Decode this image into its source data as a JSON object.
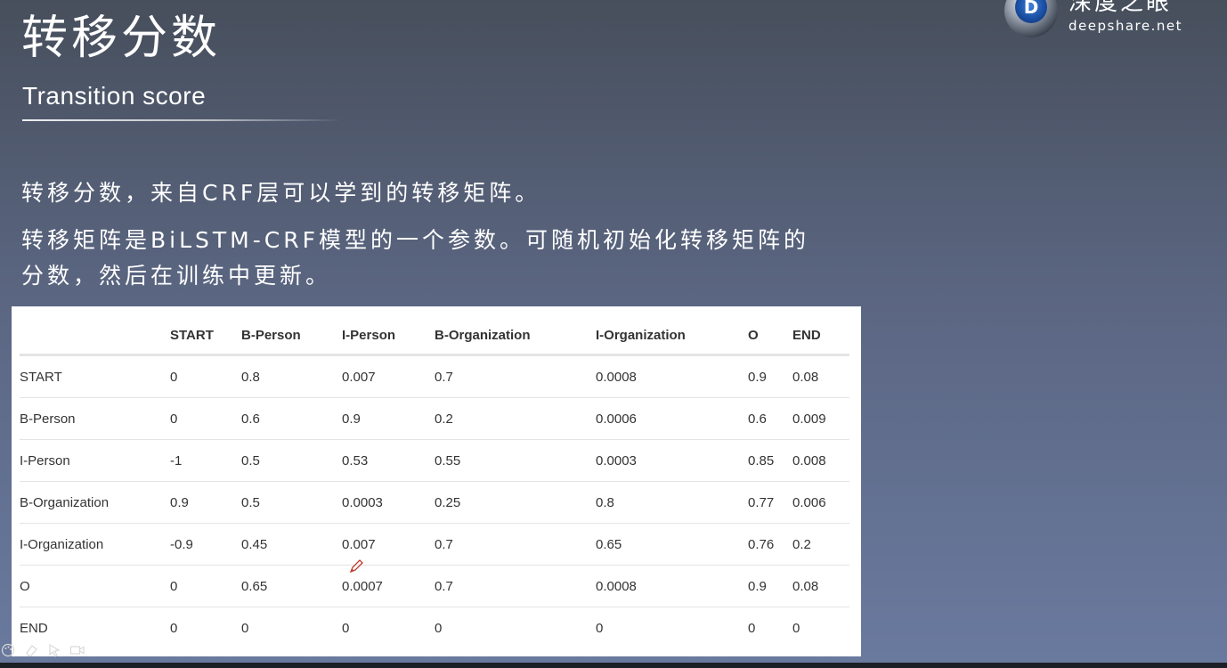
{
  "slide": {
    "title": "转移分数",
    "subtitle": "Transition score",
    "paragraph1": "转移分数，来自CRF层可以学到的转移矩阵。",
    "paragraph2_line1": "转移矩阵是BiLSTM-CRF模型的一个参数。可随机初始化转移矩阵的",
    "paragraph2_line2": "分数，然后在训练中更新。"
  },
  "logo": {
    "cn": "深度之眼",
    "en": "deepshare.net",
    "mark": "D"
  },
  "table": {
    "headers": [
      "",
      "START",
      "B-Person",
      "I-Person",
      "B-Organization",
      "I-Organization",
      "O",
      "END"
    ],
    "rows": [
      [
        "START",
        "0",
        "0.8",
        "0.007",
        "0.7",
        "0.0008",
        "0.9",
        "0.08"
      ],
      [
        "B-Person",
        "0",
        "0.6",
        "0.9",
        "0.2",
        "0.0006",
        "0.6",
        "0.009"
      ],
      [
        "I-Person",
        "-1",
        "0.5",
        "0.53",
        "0.55",
        "0.0003",
        "0.85",
        "0.008"
      ],
      [
        "B-Organization",
        "0.9",
        "0.5",
        "0.0003",
        "0.25",
        "0.8",
        "0.77",
        "0.006"
      ],
      [
        "I-Organization",
        "-0.9",
        "0.45",
        "0.007",
        "0.7",
        "0.65",
        "0.76",
        "0.2"
      ],
      [
        "O",
        "0",
        "0.65",
        "0.0007",
        "0.7",
        "0.0008",
        "0.9",
        "0.08"
      ],
      [
        "END",
        "0",
        "0",
        "0",
        "0",
        "0",
        "0",
        "0"
      ]
    ]
  },
  "toolbar": {
    "icons": [
      "palette-icon",
      "eraser-icon",
      "pointer-icon",
      "camera-icon"
    ]
  },
  "colors": {
    "bg_top": "#474f5c",
    "bg_bottom": "#6a7a9f",
    "table_bg": "#ffffff",
    "table_text": "#333333",
    "logo_blue": "#1a4fa3"
  }
}
